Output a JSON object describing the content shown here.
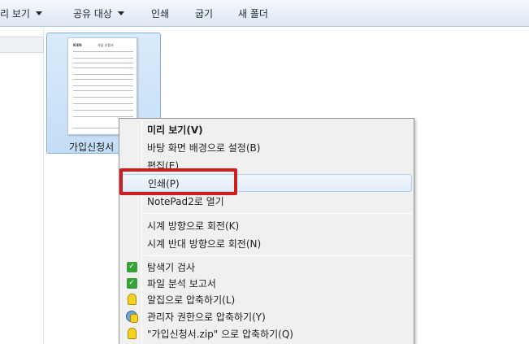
{
  "toolbar": {
    "preview_label": "리 보기",
    "share_label": "공유 대상",
    "print_label": "인쇄",
    "burn_label": "굽기",
    "new_folder_label": "새 폴더"
  },
  "file": {
    "name": "가입신청서",
    "thumb_logo": "KIDS",
    "thumb_title": "가입 신청서"
  },
  "context_menu": {
    "items": [
      {
        "label": "미리 보기(V)",
        "bold": true
      },
      {
        "label": "바탕 화면 배경으로 설정(B)"
      },
      {
        "label": "편집(E)"
      },
      {
        "label": "인쇄(P)",
        "hover": true
      },
      {
        "label": "NotePad2로 열기"
      },
      {
        "label": "시계 방향으로 회전(K)"
      },
      {
        "label": "시계 반대 방향으로 회전(N)"
      },
      {
        "label": "탐색기 검사",
        "icon": "v3-shield-icon"
      },
      {
        "label": "파일 분석 보고서",
        "icon": "v3-report-icon"
      },
      {
        "label": "알집으로 압축하기(L)",
        "icon": "alzip-icon"
      },
      {
        "label": "관리자 권한으로 압축하기(Y)",
        "icon": "admin-compress-icon"
      },
      {
        "label": "\"가입신청서.zip\" 으로 압축하기(Q)",
        "icon": "alzip-zip-icon"
      }
    ]
  },
  "colors": {
    "highlight": "#cc1f1f",
    "selection": "#c4ddf6",
    "menu_bg": "#f0f0f0"
  }
}
